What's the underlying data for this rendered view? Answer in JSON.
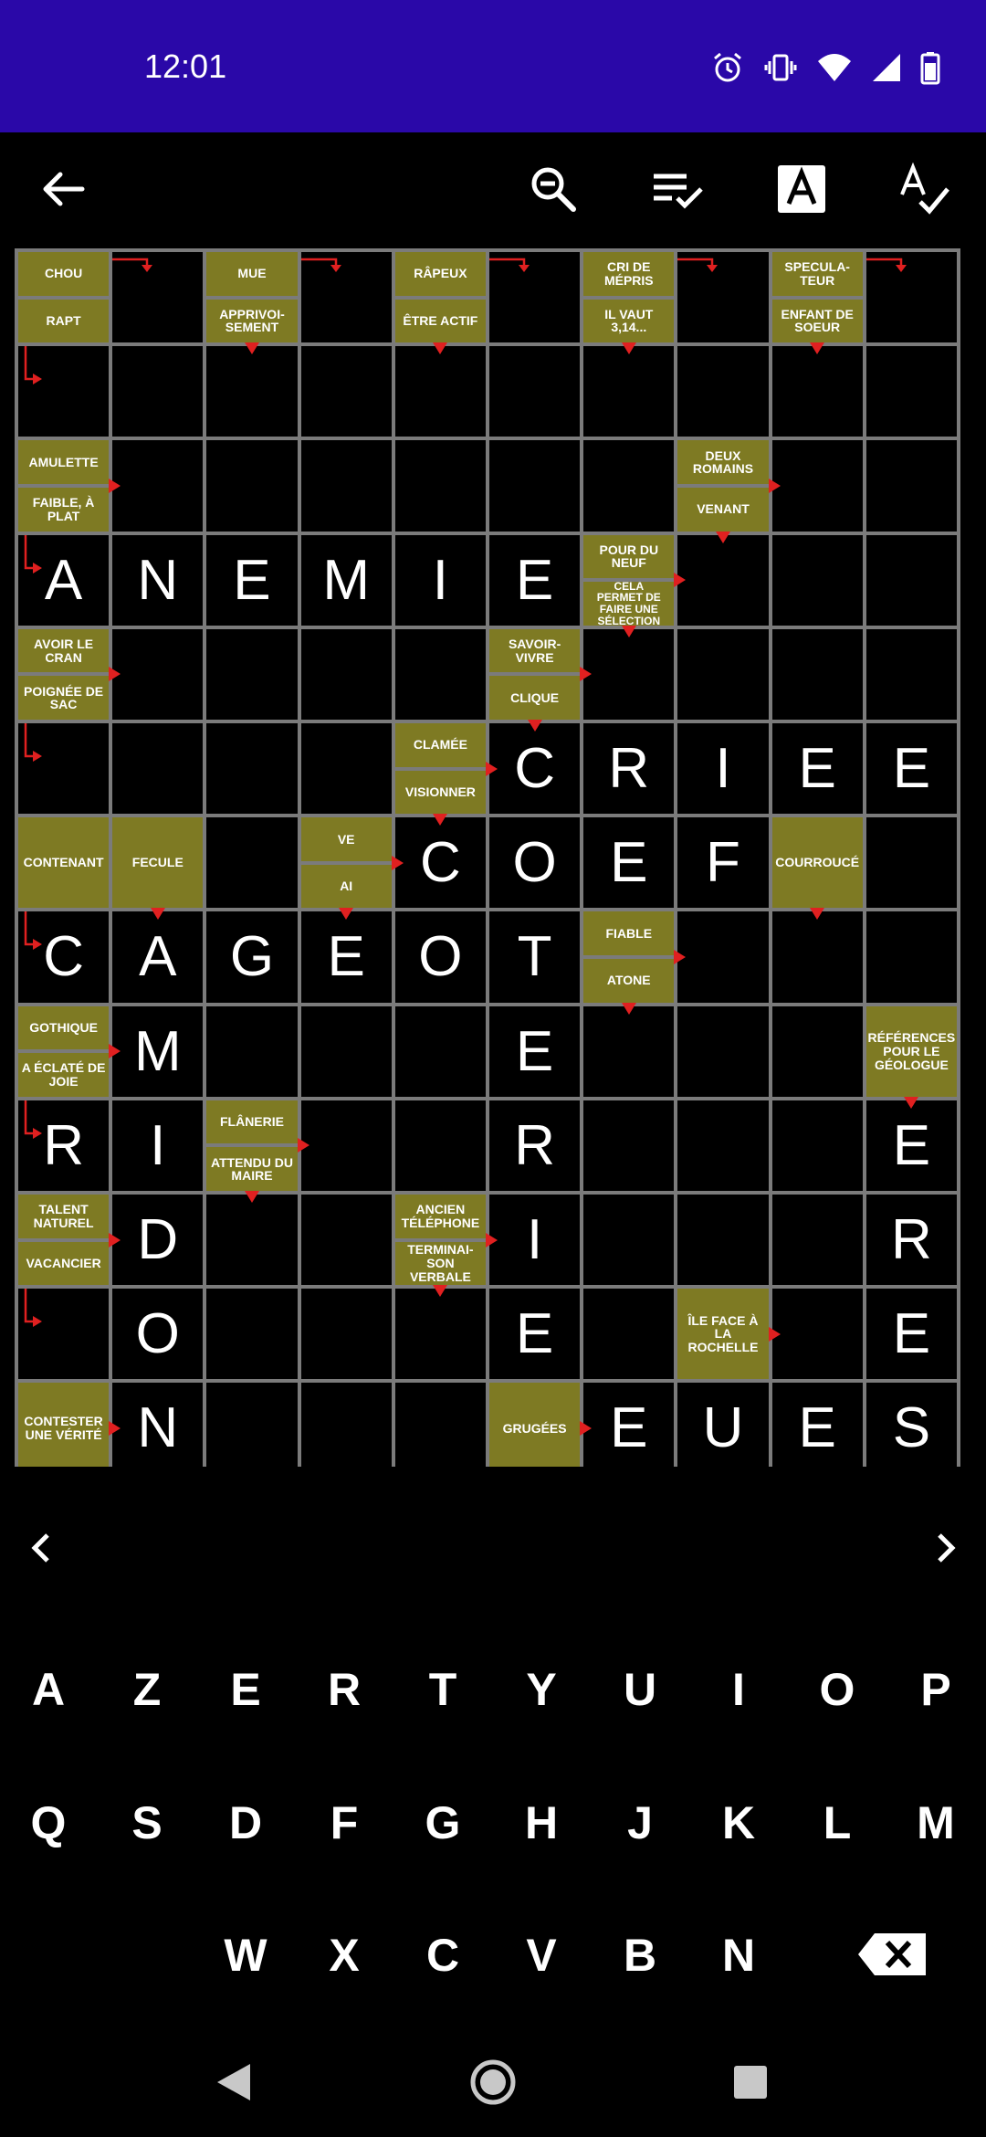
{
  "status_bar": {
    "time": "12:01",
    "icons": [
      "alarm-icon",
      "vibrate-icon",
      "wifi-icon",
      "signal-icon",
      "battery-icon"
    ],
    "background": "#2A08A8"
  },
  "toolbar": {
    "icons": [
      "back-arrow-icon",
      "zoom-out-icon",
      "clue-list-check-icon",
      "letter-a-box-icon",
      "spell-check-icon"
    ]
  },
  "colors": {
    "clue_background": "#7e7a23",
    "grid_line": "#7b7b7b",
    "arrow": "#e02020"
  },
  "grid": {
    "cols": 10,
    "rows": 13,
    "letters": [
      [
        "",
        "",
        "",
        "",
        "",
        "",
        "",
        "",
        "",
        ""
      ],
      [
        "",
        "",
        "",
        "",
        "",
        "",
        "",
        "",
        "",
        ""
      ],
      [
        "",
        "",
        "",
        "",
        "",
        "",
        "",
        "",
        "",
        ""
      ],
      [
        "A",
        "N",
        "E",
        "M",
        "I",
        "E",
        "",
        "",
        "",
        ""
      ],
      [
        "",
        "",
        "",
        "",
        "",
        "",
        "",
        "",
        "",
        ""
      ],
      [
        "",
        "",
        "",
        "",
        "",
        "C",
        "R",
        "I",
        "E",
        "E"
      ],
      [
        "",
        "",
        "",
        "",
        "C",
        "O",
        "E",
        "F",
        "",
        ""
      ],
      [
        "C",
        "A",
        "G",
        "E",
        "O",
        "T",
        "",
        "",
        "",
        ""
      ],
      [
        "",
        "M",
        "",
        "",
        "",
        "E",
        "",
        "",
        "",
        ""
      ],
      [
        "R",
        "I",
        "",
        "",
        "",
        "R",
        "",
        "",
        "",
        "E"
      ],
      [
        "",
        "D",
        "",
        "",
        "",
        "I",
        "",
        "",
        "",
        "R"
      ],
      [
        "",
        "O",
        "",
        "",
        "",
        "E",
        "",
        "",
        "",
        "E"
      ],
      [
        "",
        "N",
        "",
        "",
        "",
        "",
        "E",
        "U",
        "E",
        "S"
      ]
    ],
    "clues": [
      {
        "r": 0,
        "c": 0,
        "parts": [
          "CHOU",
          "RAPT"
        ]
      },
      {
        "r": 0,
        "c": 2,
        "parts": [
          "MUE",
          "APPRIVOI-\nSEMENT"
        ]
      },
      {
        "r": 0,
        "c": 4,
        "parts": [
          "RÂPEUX",
          "ÊTRE ACTIF"
        ]
      },
      {
        "r": 0,
        "c": 6,
        "parts": [
          "CRI DE\nMÉPRIS",
          "IL VAUT\n3,14..."
        ]
      },
      {
        "r": 0,
        "c": 8,
        "parts": [
          "SPECULA-\nTEUR",
          "ENFANT DE\nSOEUR"
        ]
      },
      {
        "r": 2,
        "c": 0,
        "parts": [
          "AMULETTE",
          "FAIBLE, À\nPLAT"
        ]
      },
      {
        "r": 2,
        "c": 7,
        "parts": [
          "DEUX\nROMAINS",
          "VENANT"
        ]
      },
      {
        "r": 3,
        "c": 6,
        "parts": [
          "POUR DU\nNEUF",
          "CELA\nPERMET DE\nFAIRE UNE\nSÉLECTION"
        ]
      },
      {
        "r": 4,
        "c": 0,
        "parts": [
          "AVOIR LE\nCRAN",
          "POIGNÉE DE\nSAC"
        ]
      },
      {
        "r": 4,
        "c": 5,
        "parts": [
          "SAVOIR-\nVIVRE",
          "CLIQUE"
        ]
      },
      {
        "r": 5,
        "c": 4,
        "parts": [
          "CLAMÉE",
          "VISIONNER"
        ]
      },
      {
        "r": 6,
        "c": 0,
        "parts": [
          "CONTENANT"
        ]
      },
      {
        "r": 6,
        "c": 1,
        "parts": [
          "FECULE"
        ]
      },
      {
        "r": 6,
        "c": 3,
        "parts": [
          "VE",
          "AI"
        ]
      },
      {
        "r": 6,
        "c": 8,
        "parts": [
          "COURROUCÉ"
        ]
      },
      {
        "r": 7,
        "c": 6,
        "parts": [
          "FIABLE",
          "ATONE"
        ]
      },
      {
        "r": 8,
        "c": 0,
        "parts": [
          "GOTHIQUE",
          "A ÉCLATÉ DE\nJOIE"
        ]
      },
      {
        "r": 8,
        "c": 9,
        "parts": [
          "RÉFÉRENCES\nPOUR LE\nGÉOLOGUE"
        ]
      },
      {
        "r": 9,
        "c": 2,
        "parts": [
          "FLÂNERIE",
          "ATTENDU DU\nMAIRE"
        ]
      },
      {
        "r": 10,
        "c": 0,
        "parts": [
          "TALENT\nNATUREL",
          "VACANCIER"
        ]
      },
      {
        "r": 10,
        "c": 4,
        "parts": [
          "ANCIEN\nTÉLÉPHONE",
          "TERMINAI-\nSON VERBALE"
        ]
      },
      {
        "r": 11,
        "c": 7,
        "parts": [
          "ÎLE FACE À LA\nROCHELLE"
        ]
      },
      {
        "r": 12,
        "c": 0,
        "parts": [
          "CONTESTER\nUNE VÉRITÉ"
        ]
      },
      {
        "r": 12,
        "c": 5,
        "parts": [
          "GRUGÉES"
        ]
      }
    ]
  },
  "navigation": {
    "prev_icon": "chevron-left-icon",
    "next_icon": "chevron-right-icon"
  },
  "keyboard": {
    "row1": [
      "A",
      "Z",
      "E",
      "R",
      "T",
      "Y",
      "U",
      "I",
      "O",
      "P"
    ],
    "row2": [
      "Q",
      "S",
      "D",
      "F",
      "G",
      "H",
      "J",
      "K",
      "L",
      "M"
    ],
    "row3": [
      "W",
      "X",
      "C",
      "V",
      "B",
      "N"
    ],
    "backspace_icon": "backspace-icon"
  },
  "system_nav": [
    "back-triangle-icon",
    "home-circle-icon",
    "recents-square-icon"
  ]
}
